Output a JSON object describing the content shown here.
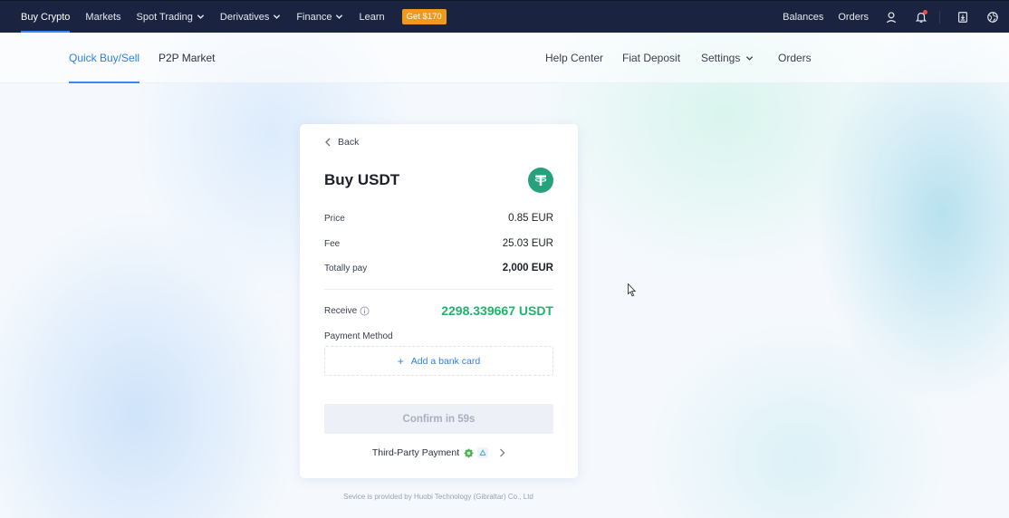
{
  "topnav": {
    "items": [
      {
        "label": "Buy Crypto",
        "active": true,
        "dropdown": false
      },
      {
        "label": "Markets",
        "active": false,
        "dropdown": false
      },
      {
        "label": "Spot Trading",
        "active": false,
        "dropdown": true
      },
      {
        "label": "Derivatives",
        "active": false,
        "dropdown": true
      },
      {
        "label": "Finance",
        "active": false,
        "dropdown": true
      },
      {
        "label": "Learn",
        "active": false,
        "dropdown": false
      }
    ],
    "promo_label": "Get $170",
    "right_items": [
      {
        "label": "Balances"
      },
      {
        "label": "Orders"
      }
    ],
    "icons": [
      "user-icon",
      "bell-icon",
      "download-icon",
      "globe-icon"
    ],
    "notification_dot": true
  },
  "subnav": {
    "tabs": [
      {
        "label": "Quick Buy/Sell",
        "active": true
      },
      {
        "label": "P2P Market",
        "active": false
      }
    ],
    "links": [
      {
        "label": "Help Center"
      },
      {
        "label": "Fiat Deposit"
      },
      {
        "label": "Settings",
        "dropdown": true
      },
      {
        "label": "Orders"
      }
    ]
  },
  "card": {
    "back_label": "Back",
    "title": "Buy USDT",
    "coin_icon": "tether-icon",
    "rows": [
      {
        "label": "Price",
        "value": "0.85 EUR"
      },
      {
        "label": "Fee",
        "value": "25.03 EUR"
      },
      {
        "label": "Totally pay",
        "value": "2,000 EUR"
      }
    ],
    "receive_label": "Receive",
    "receive_value": "2298.339667 USDT",
    "payment_method_label": "Payment Method",
    "add_card_label": "Add a bank card",
    "confirm_label": "Confirm in 59s",
    "third_party_label": "Third-Party Payment"
  },
  "footer": "Sevice is provided by Huobi Technology (Gibraltar) Co., Ltd",
  "colors": {
    "nav_bg": "#1a2440",
    "accent_blue": "#2d7ff0",
    "promo_orange": "#f09a1c",
    "receive_green": "#1db46c",
    "tether_green": "#26a17b"
  }
}
